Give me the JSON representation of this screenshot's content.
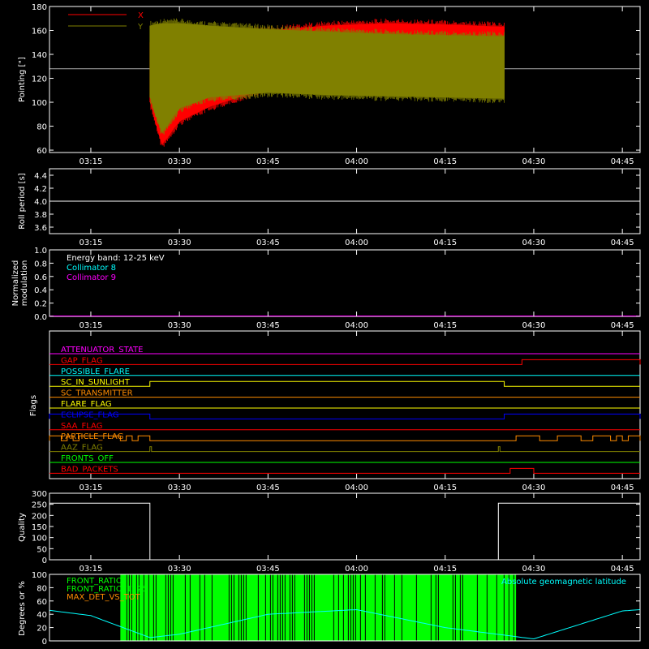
{
  "time_ticks": [
    "03:15",
    "03:30",
    "03:45",
    "04:00",
    "04:15",
    "04:30",
    "04:45"
  ],
  "colors": {
    "background": "#000000",
    "axes": "#ffffff",
    "x_pointing": "#ff0000",
    "y_pointing": "#808000",
    "collimator8": "#00ffff",
    "collimator9": "#ff00ff",
    "front_ratio": "#00ff00",
    "geomag": "#00ffff",
    "max_det": "#ff8c00"
  },
  "chart_data": [
    {
      "type": "line",
      "ylabel": "Pointing [\"]",
      "ylim": [
        58,
        180
      ],
      "yticks": [
        60,
        80,
        100,
        120,
        140,
        160,
        180
      ],
      "legend": {
        "placement": "top-left",
        "entries": [
          {
            "name": "X",
            "color": "#ff0000"
          },
          {
            "name": "Y",
            "color": "#808000"
          }
        ]
      },
      "reference_level": 128,
      "series": [
        {
          "name": "X",
          "color": "#ff0000",
          "x": [
            "03:25",
            "03:27",
            "03:30",
            "03:35",
            "03:45",
            "03:55",
            "04:05",
            "04:15",
            "04:25"
          ],
          "y_low": [
            100,
            64,
            84,
            96,
            112,
            118,
            120,
            121,
            122
          ],
          "y_high": [
            150,
            150,
            153,
            156,
            160,
            164,
            166,
            165,
            163
          ]
        },
        {
          "name": "Y",
          "color": "#808000",
          "x": [
            "03:25",
            "03:27",
            "03:30",
            "03:35",
            "03:45",
            "03:55",
            "04:05",
            "04:15",
            "04:25"
          ],
          "y_low": [
            104,
            74,
            95,
            104,
            108,
            106,
            105,
            104,
            103
          ],
          "y_high": [
            164,
            166,
            166,
            164,
            161,
            159,
            157,
            156,
            155
          ]
        }
      ]
    },
    {
      "type": "line",
      "ylabel": "Roll period [s]",
      "ylim": [
        3.5,
        4.5
      ],
      "yticks": [
        3.6,
        3.8,
        4.0,
        4.2,
        4.4
      ],
      "series": [
        {
          "x": [
            "03:08",
            "04:48"
          ],
          "y": [
            4.0,
            4.0
          ]
        }
      ]
    },
    {
      "type": "line",
      "ylabel": "Normalized modulation",
      "ylim": [
        0,
        1.0
      ],
      "yticks": [
        0.0,
        0.2,
        0.4,
        0.6,
        0.8,
        1.0
      ],
      "annotation": "Energy band: 12-25 keV",
      "series": [
        {
          "name": "Collimator 8",
          "color": "#00ffff",
          "x": [
            "03:08",
            "04:48"
          ],
          "y": [
            0,
            0
          ]
        },
        {
          "name": "Collimator 9",
          "color": "#ff00ff",
          "x": [
            "03:08",
            "04:48"
          ],
          "y": [
            0,
            0
          ]
        }
      ]
    },
    {
      "type": "line",
      "ylabel": "Flags",
      "flags": [
        {
          "name": "ATTENUATOR_STATE",
          "color": "#ff00ff"
        },
        {
          "name": "GAP_FLAG",
          "color": "#ff0000"
        },
        {
          "name": "POSSIBLE_FLARE",
          "color": "#00ffff"
        },
        {
          "name": "SC_IN_SUNLIGHT",
          "color": "#ffff00"
        },
        {
          "name": "SC_TRANSMITTER",
          "color": "#ff8c00"
        },
        {
          "name": "FLARE_FLAG",
          "color": "#ffff00"
        },
        {
          "name": "ECLIPSE_FLAG",
          "color": "#0000ff"
        },
        {
          "name": "SAA_FLAG",
          "color": "#ff0000"
        },
        {
          "name": "PARTICLE_FLAG",
          "color": "#ff8c00"
        },
        {
          "name": "AAZ_FLAG",
          "color": "#808000"
        },
        {
          "name": "FRONTS_OFF",
          "color": "#00ff00"
        },
        {
          "name": "BAD_PACKETS",
          "color": "#ff0000"
        }
      ],
      "flag_high_intervals": {
        "GAP_FLAG": [
          [
            "04:28",
            "04:48"
          ]
        ],
        "SC_IN_SUNLIGHT": [
          [
            "03:25",
            "04:25"
          ]
        ],
        "ECLIPSE_FLAG": [
          [
            "03:08",
            "03:25"
          ],
          [
            "04:25",
            "04:48"
          ]
        ],
        "PARTICLE_FLAG": [
          [
            "03:08",
            "03:10"
          ],
          [
            "03:11",
            "03:12"
          ],
          [
            "03:13",
            "03:20"
          ],
          [
            "03:21",
            "03:22"
          ],
          [
            "03:23",
            "03:25"
          ],
          [
            "04:27",
            "04:31"
          ],
          [
            "04:34",
            "04:38"
          ],
          [
            "04:40",
            "04:43"
          ],
          [
            "04:44",
            "04:45"
          ],
          [
            "04:46",
            "04:48"
          ]
        ],
        "AAZ_FLAG": [
          [
            "03:25",
            "03:25"
          ],
          [
            "04:24",
            "04:24"
          ]
        ],
        "BAD_PACKETS": [
          [
            "04:26",
            "04:30"
          ]
        ]
      }
    },
    {
      "type": "line",
      "ylabel": "Quality",
      "ylim": [
        0,
        300
      ],
      "yticks": [
        0,
        50,
        100,
        150,
        200,
        250,
        300
      ],
      "series": [
        {
          "x": [
            "03:08",
            "03:25",
            "03:25",
            "04:24",
            "04:24",
            "04:48"
          ],
          "y": [
            255,
            255,
            0,
            0,
            255,
            255
          ]
        }
      ]
    },
    {
      "type": "area",
      "ylabel": "Degrees or %",
      "ylim": [
        0,
        100
      ],
      "yticks": [
        0,
        20,
        40,
        60,
        80,
        100
      ],
      "legend": {
        "placement": "top-left",
        "entries": [
          {
            "name": "FRONT_RATIO",
            "color": "#00ff00"
          },
          {
            "name": "FRONT_RATIO_1225",
            "color": "#00ff00"
          },
          {
            "name": "MAX_DET_VS_TOT",
            "color": "#ff8c00"
          }
        ]
      },
      "annotation": "Absolute geomagnetic latitude",
      "front_ratio_interval": [
        "03:20",
        "04:27"
      ],
      "series": [
        {
          "name": "Absolute geomagnetic latitude",
          "color": "#00ffff",
          "x": [
            "03:08",
            "03:15",
            "03:25",
            "03:30",
            "03:45",
            "04:00",
            "04:15",
            "04:30",
            "04:45",
            "04:48"
          ],
          "y": [
            46,
            38,
            5,
            10,
            40,
            47,
            20,
            3,
            45,
            47
          ]
        }
      ]
    }
  ]
}
